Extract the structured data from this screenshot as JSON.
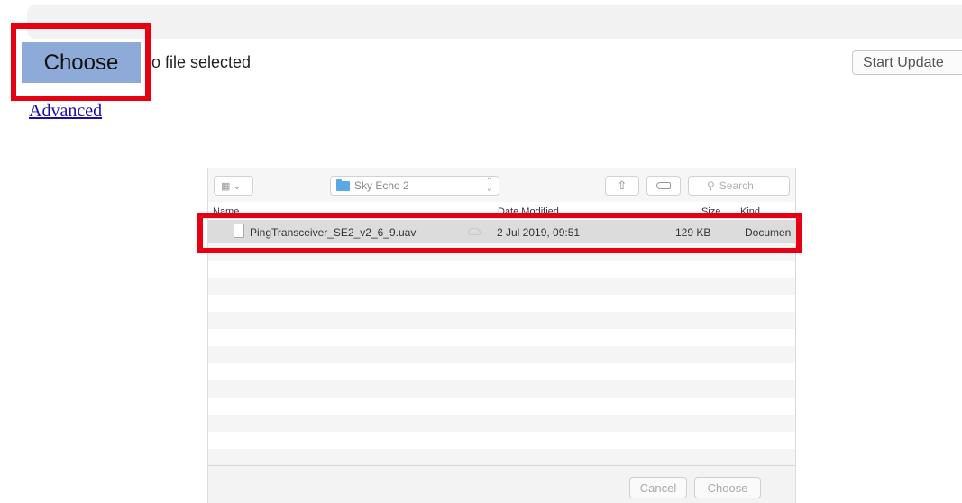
{
  "page": {
    "choose_label": "Choose",
    "no_file_text": "o file selected",
    "start_update_label": "Start Update",
    "advanced_label": "Advanced"
  },
  "dialog": {
    "location": "Sky Echo 2",
    "search_placeholder": "Search",
    "columns": {
      "name": "Name",
      "date_modified": "Date Modified",
      "size": "Size",
      "kind": "Kind"
    },
    "files": [
      {
        "name": "PingTransceiver_SE2_v2_6_9.uav",
        "date_modified": "2 Jul 2019, 09:51",
        "size": "129 KB",
        "kind": "Documen"
      }
    ],
    "cancel_label": "Cancel",
    "choose_label": "Choose"
  },
  "colors": {
    "highlight": "#e60012",
    "choose_button": "#8eaad8",
    "link": "#1a0dab"
  }
}
